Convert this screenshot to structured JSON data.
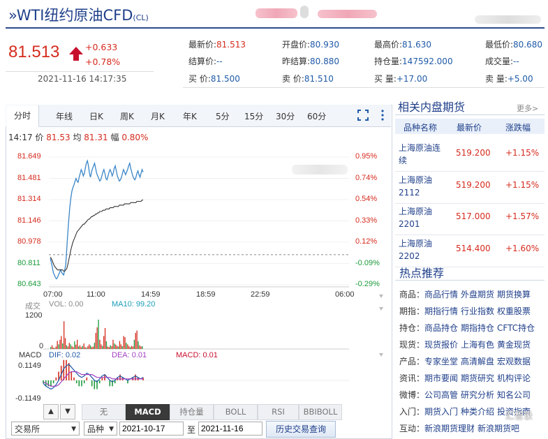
{
  "header": {
    "title": "WTI纽约原油CFD",
    "code": "(CL)"
  },
  "price": {
    "last": "81.513",
    "change": "+0.633",
    "change_pct": "+0.78%",
    "datetime": "2021-11-16 14:17:35"
  },
  "quotes": [
    [
      {
        "label": "最新价:",
        "value": "81.513",
        "color": "red"
      },
      {
        "label": "开盘价:",
        "value": "80.930",
        "color": "blue"
      },
      {
        "label": "最高价:",
        "value": "81.630",
        "color": "blue"
      },
      {
        "label": "最低价:",
        "value": "80.680",
        "color": "blue"
      }
    ],
    [
      {
        "label": "结算价:",
        "value": "--",
        "color": "blue"
      },
      {
        "label": "昨结算:",
        "value": "80.880",
        "color": "blue"
      },
      {
        "label": "持仓量:",
        "value": "147592.000",
        "color": "blue"
      },
      {
        "label": "成交量:",
        "value": "--",
        "color": "blue"
      }
    ],
    [
      {
        "label": "买  价:",
        "value": "81.500",
        "color": "blue"
      },
      {
        "label": "卖  价:",
        "value": "81.510",
        "color": "blue"
      },
      {
        "label": "买  量:",
        "value": "+17.00",
        "color": "blue"
      },
      {
        "label": "卖  量:",
        "value": "+5.00",
        "color": "blue"
      }
    ]
  ],
  "tabs": [
    "分时",
    "年线",
    "日K",
    "周K",
    "月K",
    "年K",
    "5分",
    "15分",
    "30分",
    "60分"
  ],
  "info": {
    "time": "14:17",
    "price_label": "价",
    "price": "81.53",
    "avg_label": "均",
    "avg": "81.31",
    "amp_label": "幅",
    "amp": "0.80%"
  },
  "chart_data": {
    "type": "line",
    "y_ticks": [
      "81.649",
      "81.481",
      "81.314",
      "81.146",
      "80.978",
      "80.811",
      "80.643"
    ],
    "pct_ticks": [
      "0.95%",
      "0.74%",
      "0.54%",
      "0.33%",
      "0.12%",
      "-0.09%",
      "-0.29%"
    ],
    "x_ticks": [
      "07:00",
      "11:00",
      "14:59",
      "18:59",
      "22:59",
      "06:00"
    ],
    "ylim": [
      80.643,
      81.649
    ],
    "prev_close": 80.88,
    "series": [
      {
        "values": [
          80.85,
          80.82,
          80.78,
          80.74,
          80.72,
          80.7,
          80.69,
          80.7,
          80.72,
          80.74,
          80.76,
          80.74,
          80.73,
          80.72,
          80.76,
          80.8,
          80.92,
          81.05,
          81.16,
          81.26,
          81.33,
          81.38,
          81.41,
          81.43,
          81.46,
          81.48,
          81.46,
          81.45,
          81.49,
          81.52,
          81.55,
          81.53,
          81.5,
          81.52,
          81.56,
          81.6,
          81.62,
          81.58,
          81.52,
          81.49,
          81.53,
          81.56,
          81.58,
          81.6,
          81.56,
          81.52,
          81.5,
          81.48,
          81.46,
          81.47,
          81.5,
          81.53,
          81.55,
          81.52,
          81.48,
          81.47,
          81.5,
          81.53,
          81.55,
          81.53,
          81.5,
          81.52,
          81.56,
          81.58,
          81.54,
          81.5,
          81.48,
          81.46,
          81.47,
          81.49,
          81.52,
          81.55,
          81.53,
          81.51,
          81.53,
          81.55,
          81.58,
          81.6,
          81.56,
          81.53,
          81.5,
          81.48,
          81.47,
          81.49,
          81.52,
          81.54,
          81.51,
          81.49,
          81.52,
          81.55,
          81.53
        ]
      },
      {
        "values": [
          80.86,
          80.85,
          80.83,
          80.81,
          80.79,
          80.78,
          80.77,
          80.76,
          80.76,
          80.76,
          80.76,
          80.76,
          80.76,
          80.75,
          80.75,
          80.76,
          80.77,
          80.8,
          80.84,
          80.88,
          80.92,
          80.95,
          80.98,
          81.0,
          81.02,
          81.04,
          81.06,
          81.07,
          81.08,
          81.09,
          81.1,
          81.11,
          81.12,
          81.12,
          81.13,
          81.14,
          81.15,
          81.16,
          81.16,
          81.17,
          81.18,
          81.18,
          81.19,
          81.19,
          81.2,
          81.2,
          81.21,
          81.21,
          81.22,
          81.22,
          81.22,
          81.23,
          81.23,
          81.23,
          81.24,
          81.24,
          81.24,
          81.24,
          81.25,
          81.25,
          81.25,
          81.25,
          81.26,
          81.26,
          81.26,
          81.26,
          81.26,
          81.27,
          81.27,
          81.27,
          81.27,
          81.27,
          81.28,
          81.28,
          81.28,
          81.28,
          81.28,
          81.28,
          81.29,
          81.29,
          81.29,
          81.29,
          81.29,
          81.29,
          81.3,
          81.3,
          81.3,
          81.3,
          81.3,
          81.31,
          81.31
        ]
      }
    ],
    "volume": {
      "label": "成交",
      "vol": "VOL: 0.00",
      "ma10": "MA10: 99.20",
      "ticks": [
        "1200",
        "0"
      ],
      "values": [
        60,
        120,
        40,
        30,
        80,
        260,
        150,
        300,
        420,
        180,
        900,
        350,
        120,
        80,
        200,
        150,
        90,
        60,
        250,
        140,
        300,
        80,
        120,
        60,
        100,
        180,
        60,
        40,
        90,
        150,
        110,
        60,
        80,
        200,
        520,
        700,
        950,
        300,
        150,
        100,
        420,
        680,
        250,
        80,
        60,
        120,
        90,
        300,
        180,
        140,
        100,
        80,
        260,
        150,
        90,
        420,
        380,
        200,
        150,
        90,
        60,
        100,
        80,
        300,
        520,
        600,
        250,
        120,
        80,
        90
      ]
    },
    "macd": {
      "label": "MACD",
      "dif": "DIF: 0.02",
      "dea": "DEA: 0.01",
      "macd": "MACD: 0.01",
      "ticks": [
        "0.1149",
        "-0.1149"
      ],
      "dif_values": [
        -0.02,
        -0.04,
        -0.05,
        -0.06,
        -0.05,
        -0.03,
        0.0,
        0.04,
        0.08,
        0.1,
        0.11,
        0.09,
        0.07,
        0.05,
        0.03,
        0.02,
        0.03,
        0.05,
        0.04,
        0.02,
        0.0,
        -0.01,
        0.01,
        0.03,
        0.04,
        0.02,
        0.0,
        -0.01,
        0.0,
        0.02,
        0.03,
        0.02,
        0.01,
        0.0,
        0.01,
        0.02,
        0.03,
        0.02,
        0.01,
        0.02
      ],
      "dea_values": [
        -0.01,
        -0.02,
        -0.03,
        -0.04,
        -0.04,
        -0.04,
        -0.03,
        -0.01,
        0.01,
        0.03,
        0.05,
        0.06,
        0.06,
        0.06,
        0.05,
        0.04,
        0.04,
        0.04,
        0.04,
        0.04,
        0.03,
        0.02,
        0.02,
        0.02,
        0.02,
        0.02,
        0.02,
        0.01,
        0.01,
        0.01,
        0.01,
        0.01,
        0.01,
        0.01,
        0.01,
        0.01,
        0.01,
        0.01,
        0.01,
        0.01
      ],
      "hist_values": [
        -0.02,
        -0.04,
        -0.04,
        -0.04,
        -0.02,
        0.02,
        0.06,
        0.1,
        0.14,
        0.14,
        0.12,
        0.06,
        0.02,
        -0.02,
        -0.04,
        -0.04,
        -0.02,
        0.02,
        0.0,
        -0.04,
        -0.06,
        -0.06,
        -0.02,
        0.02,
        0.04,
        0.0,
        -0.04,
        -0.04,
        -0.02,
        0.02,
        0.04,
        0.02,
        0.0,
        -0.02,
        0.0,
        0.02,
        0.04,
        0.02,
        0.0,
        0.02
      ]
    }
  },
  "indicator_tabs": [
    "无",
    "MACD",
    "持仓量",
    "BOLL",
    "RSI",
    "BBIBOLL"
  ],
  "history": {
    "exchange": "交易所",
    "variety": "品种",
    "from": "2021-10-17",
    "to_label": "至",
    "to": "2021-11-16",
    "button": "历史交易查询"
  },
  "sidebar": {
    "futures_title": "相关内盘期货",
    "more": "更多>",
    "headers": [
      "品种名称",
      "最新价",
      "涨跌幅"
    ],
    "futures": [
      {
        "name": "上海原油连续",
        "price": "519.200",
        "pct": "+1.15%"
      },
      {
        "name": "上海原油2112",
        "price": "519.200",
        "pct": "+1.15%"
      },
      {
        "name": "上海原油2201",
        "price": "517.000",
        "pct": "+1.57%"
      },
      {
        "name": "上海原油2202",
        "price": "514.400",
        "pct": "+1.60%"
      }
    ],
    "hot_title": "热点推荐",
    "hot": [
      {
        "label": "商品：",
        "links": [
          "商品行情",
          "外盘期货",
          "期货换算"
        ]
      },
      {
        "label": "期指：",
        "links": [
          "期指行情",
          "行业指数",
          "权重股票"
        ]
      },
      {
        "label": "持仓：",
        "links": [
          "商品持仓",
          "期指持仓",
          "CFTC持仓"
        ]
      },
      {
        "label": "现货：",
        "links": [
          "现货报价",
          "上海有色",
          "黄金现货"
        ]
      },
      {
        "label": "产品：",
        "links": [
          "专家坐堂",
          "高清解盘",
          "宏观数据"
        ]
      },
      {
        "label": "资讯：",
        "links": [
          "期市要闻",
          "期货研究",
          "机构评论"
        ]
      },
      {
        "label": "微博：",
        "links": [
          "公司高管",
          "研究分析",
          "知名公司"
        ]
      },
      {
        "label": "入门：",
        "links": [
          "期货入门",
          "种类介绍",
          "投资指南"
        ]
      },
      {
        "label": "互动：",
        "links": [
          "新浪期货理财",
          "新浪期货吧"
        ]
      }
    ],
    "watermark": "汇智录"
  },
  "colors": {
    "up": "#d52b1e",
    "down": "#1a9a3a",
    "price_line": "#3a86c8",
    "avg_line": "#333333",
    "brand": "#1f3f8a"
  }
}
